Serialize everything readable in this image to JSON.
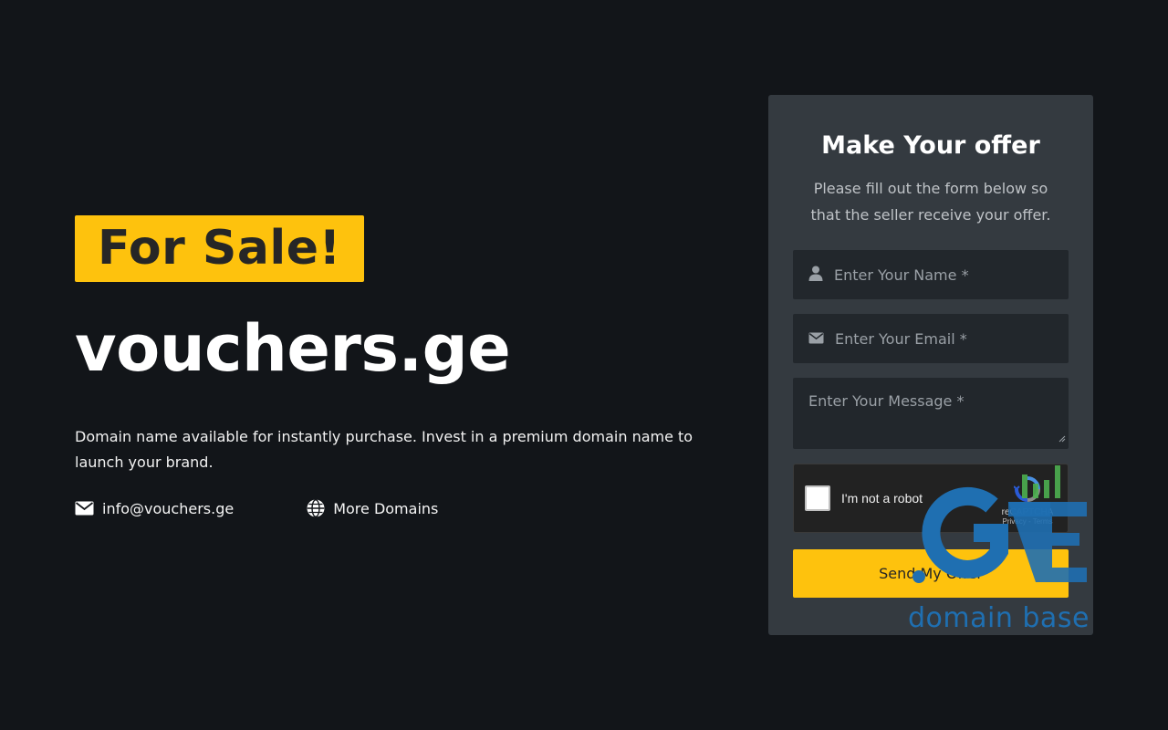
{
  "hero": {
    "badge": "For Sale!",
    "domain": "vouchers.ge",
    "description": "Domain name available for instantly purchase. Invest in a premium domain name to launch your brand.",
    "email_label": "info@vouchers.ge",
    "email_icon": "envelope-icon",
    "more_domains_label": "More Domains",
    "more_domains_icon": "globe-icon"
  },
  "form": {
    "title": "Make Your offer",
    "subtitle": "Please fill out the form below so that the seller receive your offer.",
    "name_placeholder": "Enter Your Name *",
    "name_icon": "user-icon",
    "email_placeholder": "Enter Your Email *",
    "email_icon": "envelope-icon",
    "message_placeholder": "Enter Your Message *",
    "captcha_label": "I'm not a robot",
    "captcha_brand": "reCAPTCHA",
    "captcha_links": "Privacy - Terms",
    "submit_label": "Send My Offer"
  },
  "watermark": {
    "logo_text": "domain base"
  },
  "colors": {
    "background": "#121519",
    "accent": "#fec20d",
    "card": "#343a40",
    "field": "#22272c",
    "watermark_blue": "#1f6fb1",
    "watermark_green": "#4caf50"
  }
}
